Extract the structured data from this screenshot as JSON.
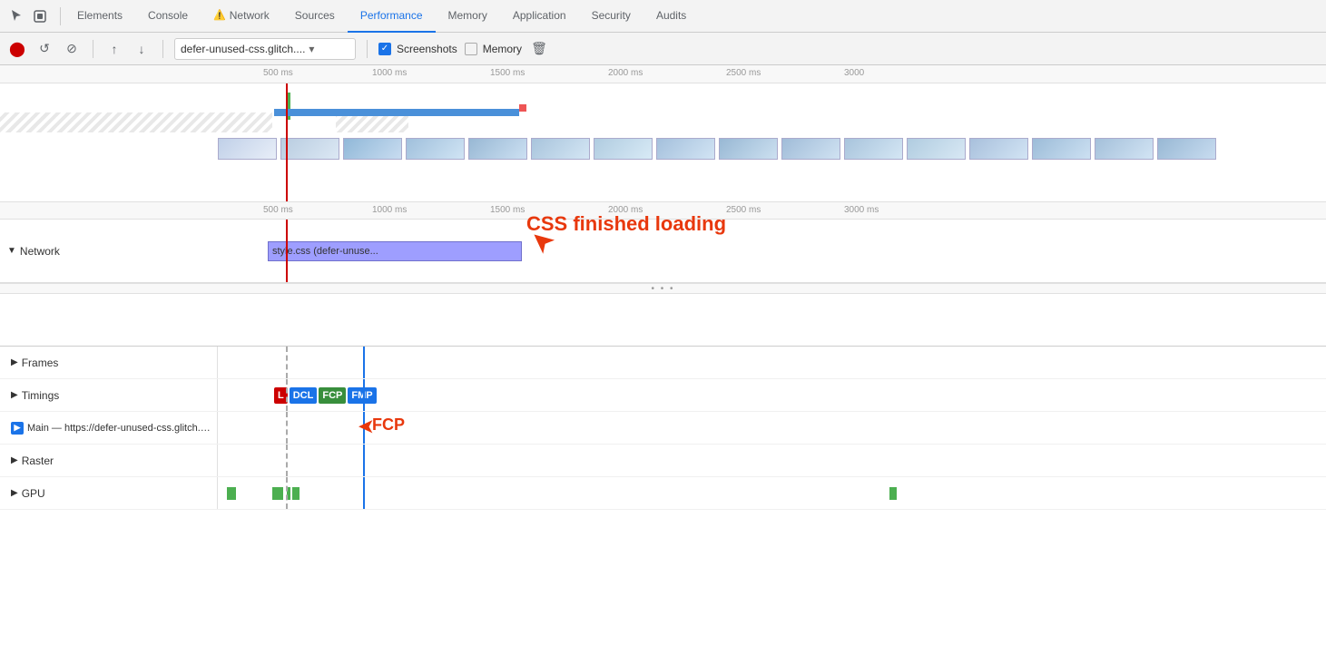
{
  "tabs": [
    {
      "id": "elements",
      "label": "Elements",
      "active": false
    },
    {
      "id": "console",
      "label": "Console",
      "active": false
    },
    {
      "id": "network",
      "label": "Network",
      "active": false,
      "warn": true
    },
    {
      "id": "sources",
      "label": "Sources",
      "active": false
    },
    {
      "id": "performance",
      "label": "Performance",
      "active": true
    },
    {
      "id": "memory",
      "label": "Memory",
      "active": false
    },
    {
      "id": "application",
      "label": "Application",
      "active": false
    },
    {
      "id": "security",
      "label": "Security",
      "active": false
    },
    {
      "id": "audits",
      "label": "Audits",
      "active": false
    }
  ],
  "toolbar": {
    "url_text": "defer-unused-css.glitch....",
    "screenshots_label": "Screenshots",
    "memory_label": "Memory",
    "trash_label": "🗑"
  },
  "timeline": {
    "ruler_ticks": [
      "500 ms",
      "1000 ms",
      "1500 ms",
      "2000 ms",
      "2500 ms",
      "3000"
    ],
    "ruler2_ticks": [
      "500 ms",
      "1000 ms",
      "1500 ms",
      "2000 ms",
      "2500 ms",
      "3000 ms"
    ]
  },
  "network_section": {
    "label": "Network",
    "css_bar_label": "style.css (defer-unuse...",
    "annotation_text": "CSS finished loading"
  },
  "tracks": [
    {
      "id": "frames",
      "label": "Frames",
      "expand": true
    },
    {
      "id": "timings",
      "label": "Timings",
      "expand": true
    },
    {
      "id": "main",
      "label": "Main — https://defer-unused-css.glitch.me/index-optimized.html",
      "expand": true,
      "blue_icon": true
    },
    {
      "id": "raster",
      "label": "Raster",
      "expand": true
    },
    {
      "id": "gpu",
      "label": "GPU",
      "expand": true
    }
  ],
  "timing_badges": [
    {
      "id": "l",
      "label": "L",
      "class": "badge-l"
    },
    {
      "id": "dcl",
      "label": "DCL",
      "class": "badge-dcl"
    },
    {
      "id": "fcp",
      "label": "FCP",
      "class": "badge-fcp"
    },
    {
      "id": "fmp",
      "label": "FMP",
      "class": "badge-fmp"
    }
  ],
  "fcp_annotation": "FCP"
}
